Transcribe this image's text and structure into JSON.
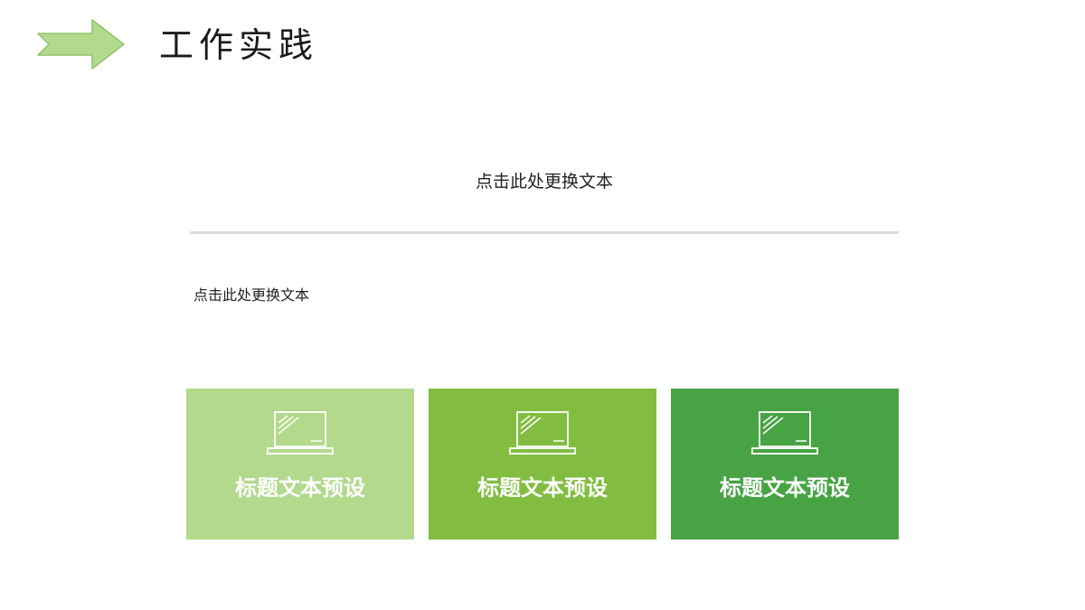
{
  "header": {
    "title": "工作实践",
    "icon": "arrow-right-icon",
    "arrow_fill": "#b3d98d",
    "arrow_stroke": "#8fc46a"
  },
  "content": {
    "subtitle": "点击此处更换文本",
    "body": "点击此处更换文本",
    "divider_color": "#dcdcdc"
  },
  "cards": [
    {
      "label": "标题文本预设",
      "icon": "laptop-icon",
      "color": "#b3d98d"
    },
    {
      "label": "标题文本预设",
      "icon": "laptop-icon",
      "color": "#82bd41"
    },
    {
      "label": "标题文本预设",
      "icon": "laptop-icon",
      "color": "#48a344"
    }
  ]
}
